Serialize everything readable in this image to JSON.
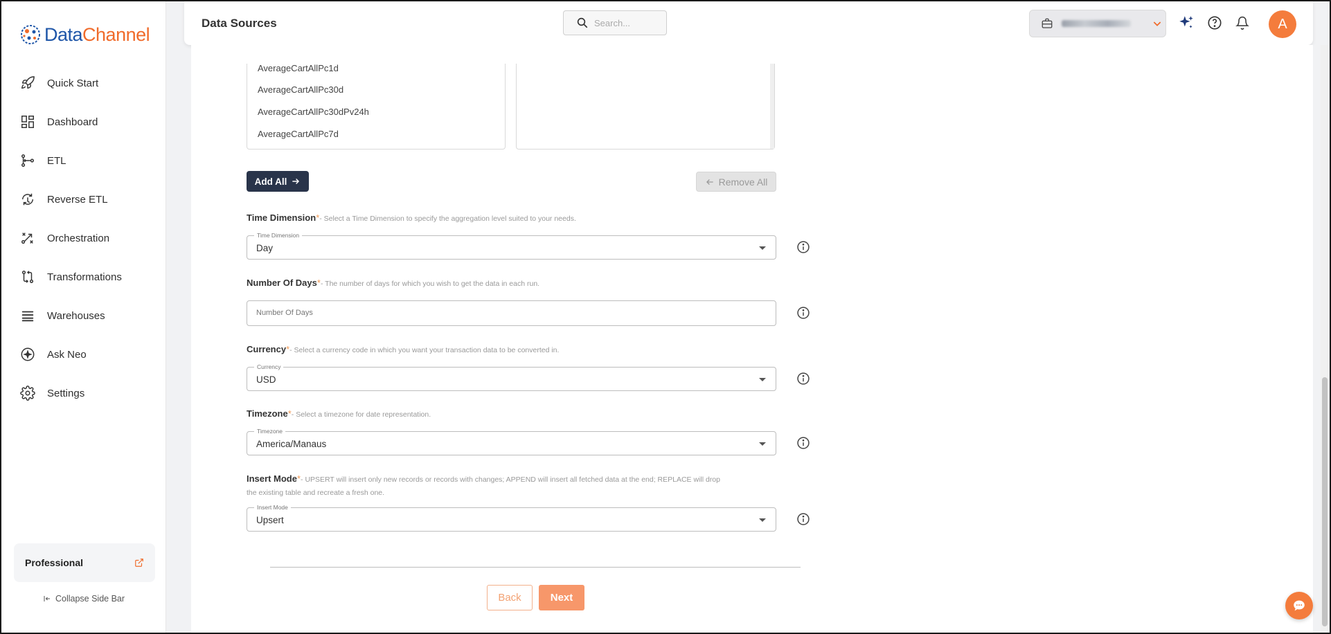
{
  "app": {
    "logo_part1": "Data",
    "logo_part2": "Channel"
  },
  "sidebar": {
    "items": [
      {
        "label": "Quick Start",
        "icon": "rocket-icon"
      },
      {
        "label": "Dashboard",
        "icon": "dashboard-icon"
      },
      {
        "label": "ETL",
        "icon": "etl-icon"
      },
      {
        "label": "Reverse ETL",
        "icon": "reverse-etl-icon"
      },
      {
        "label": "Orchestration",
        "icon": "orchestration-icon"
      },
      {
        "label": "Transformations",
        "icon": "transformations-icon"
      },
      {
        "label": "Warehouses",
        "icon": "warehouses-icon"
      },
      {
        "label": "Ask Neo",
        "icon": "ask-neo-icon"
      },
      {
        "label": "Settings",
        "icon": "gear-icon"
      }
    ],
    "plan_label": "Professional",
    "collapse_label": "Collapse Side Bar"
  },
  "header": {
    "title": "Data Sources",
    "search_placeholder": "Search...",
    "avatar_initial": "A"
  },
  "metrics": {
    "available": [
      "AverageCartAllPc1d",
      "AverageCartAllPc30d",
      "AverageCartAllPc30dPv24h",
      "AverageCartAllPc7d"
    ],
    "selected": []
  },
  "buttons": {
    "add_all": "Add All",
    "remove_all": "Remove All",
    "back": "Back",
    "next": "Next"
  },
  "fields": {
    "time_dimension": {
      "label": "Time Dimension",
      "required": "*",
      "hint": "- Select a Time Dimension to specify the aggregation level suited to your needs.",
      "legend": "Time Dimension",
      "value": "Day"
    },
    "number_of_days": {
      "label": "Number Of Days",
      "required": "*",
      "hint": "- The number of days for which you wish to get the data in each run.",
      "placeholder": "Number Of Days"
    },
    "currency": {
      "label": "Currency",
      "required": "*",
      "hint": "- Select a currency code in which you want your transaction data to be converted in.",
      "legend": "Currency",
      "value": "USD"
    },
    "timezone": {
      "label": "Timezone",
      "required": "*",
      "hint": "- Select a timezone for date representation.",
      "legend": "Timezone",
      "value": "America/Manaus"
    },
    "insert_mode": {
      "label": "Insert Mode",
      "required": "*",
      "hint": "- UPSERT will insert only new records or records with changes; APPEND will insert all fetched data at the end; REPLACE will drop the existing table and recreate a fresh one.",
      "legend": "Insert Mode",
      "value": "Upsert"
    }
  },
  "colors": {
    "brand_blue": "#1f56a8",
    "brand_orange": "#f06b2b",
    "primary_dark": "#29344a",
    "accent_orange": "#f7976a"
  }
}
